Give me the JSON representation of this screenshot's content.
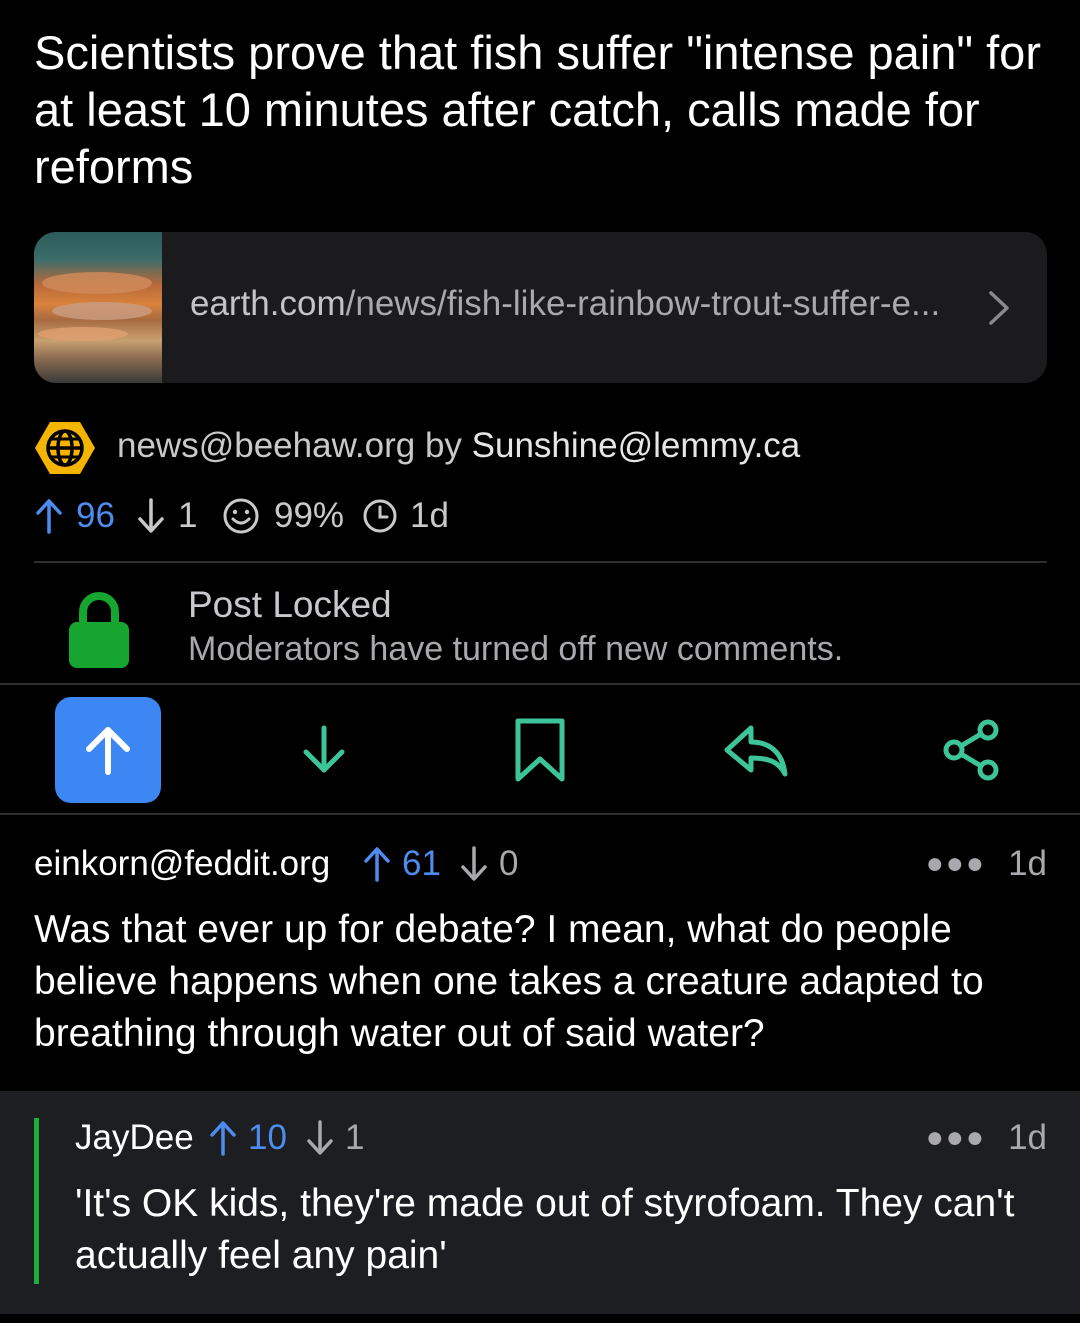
{
  "post": {
    "title": "Scientists prove that fish suffer \"intense pain\" for at least 10 minutes after catch, calls made for reforms",
    "link": {
      "domain": "earth.com",
      "path": "/news/fish-like-rainbow-trout-suffer-e...",
      "chevron_icon": "chevron-right-icon"
    },
    "community": "news@beehaw.org",
    "by_word": "by",
    "author": "Sunshine@lemmy.ca",
    "upvotes": "96",
    "downvotes": "1",
    "score_percent": "99%",
    "age": "1d",
    "lock": {
      "title": "Post Locked",
      "subtitle": "Moderators have turned off new comments."
    }
  },
  "actions": [
    {
      "name": "upvote",
      "icon": "arrow-up-icon",
      "active": true
    },
    {
      "name": "downvote",
      "icon": "arrow-down-icon",
      "active": false
    },
    {
      "name": "save",
      "icon": "bookmark-icon",
      "active": false
    },
    {
      "name": "reply",
      "icon": "reply-icon",
      "active": false
    },
    {
      "name": "share",
      "icon": "share-icon",
      "active": false
    }
  ],
  "comments": [
    {
      "user": "einkorn@feddit.org",
      "upvotes": "61",
      "downvotes": "0",
      "age": "1d",
      "body": "Was that ever up for debate? I mean, what do people believe happens when one takes a creature adapted to breathing through water out of said water?"
    },
    {
      "user": "JayDee",
      "upvotes": "10",
      "downvotes": "1",
      "age": "1d",
      "body": "'It's OK kids, they're made out of styrofoam. They can't actually feel any pain'"
    }
  ],
  "colors": {
    "accent_blue": "#3d87f5",
    "action_green": "#3ec49a",
    "lock_green": "#16a52f",
    "thread_bar": "#1fae3e"
  }
}
